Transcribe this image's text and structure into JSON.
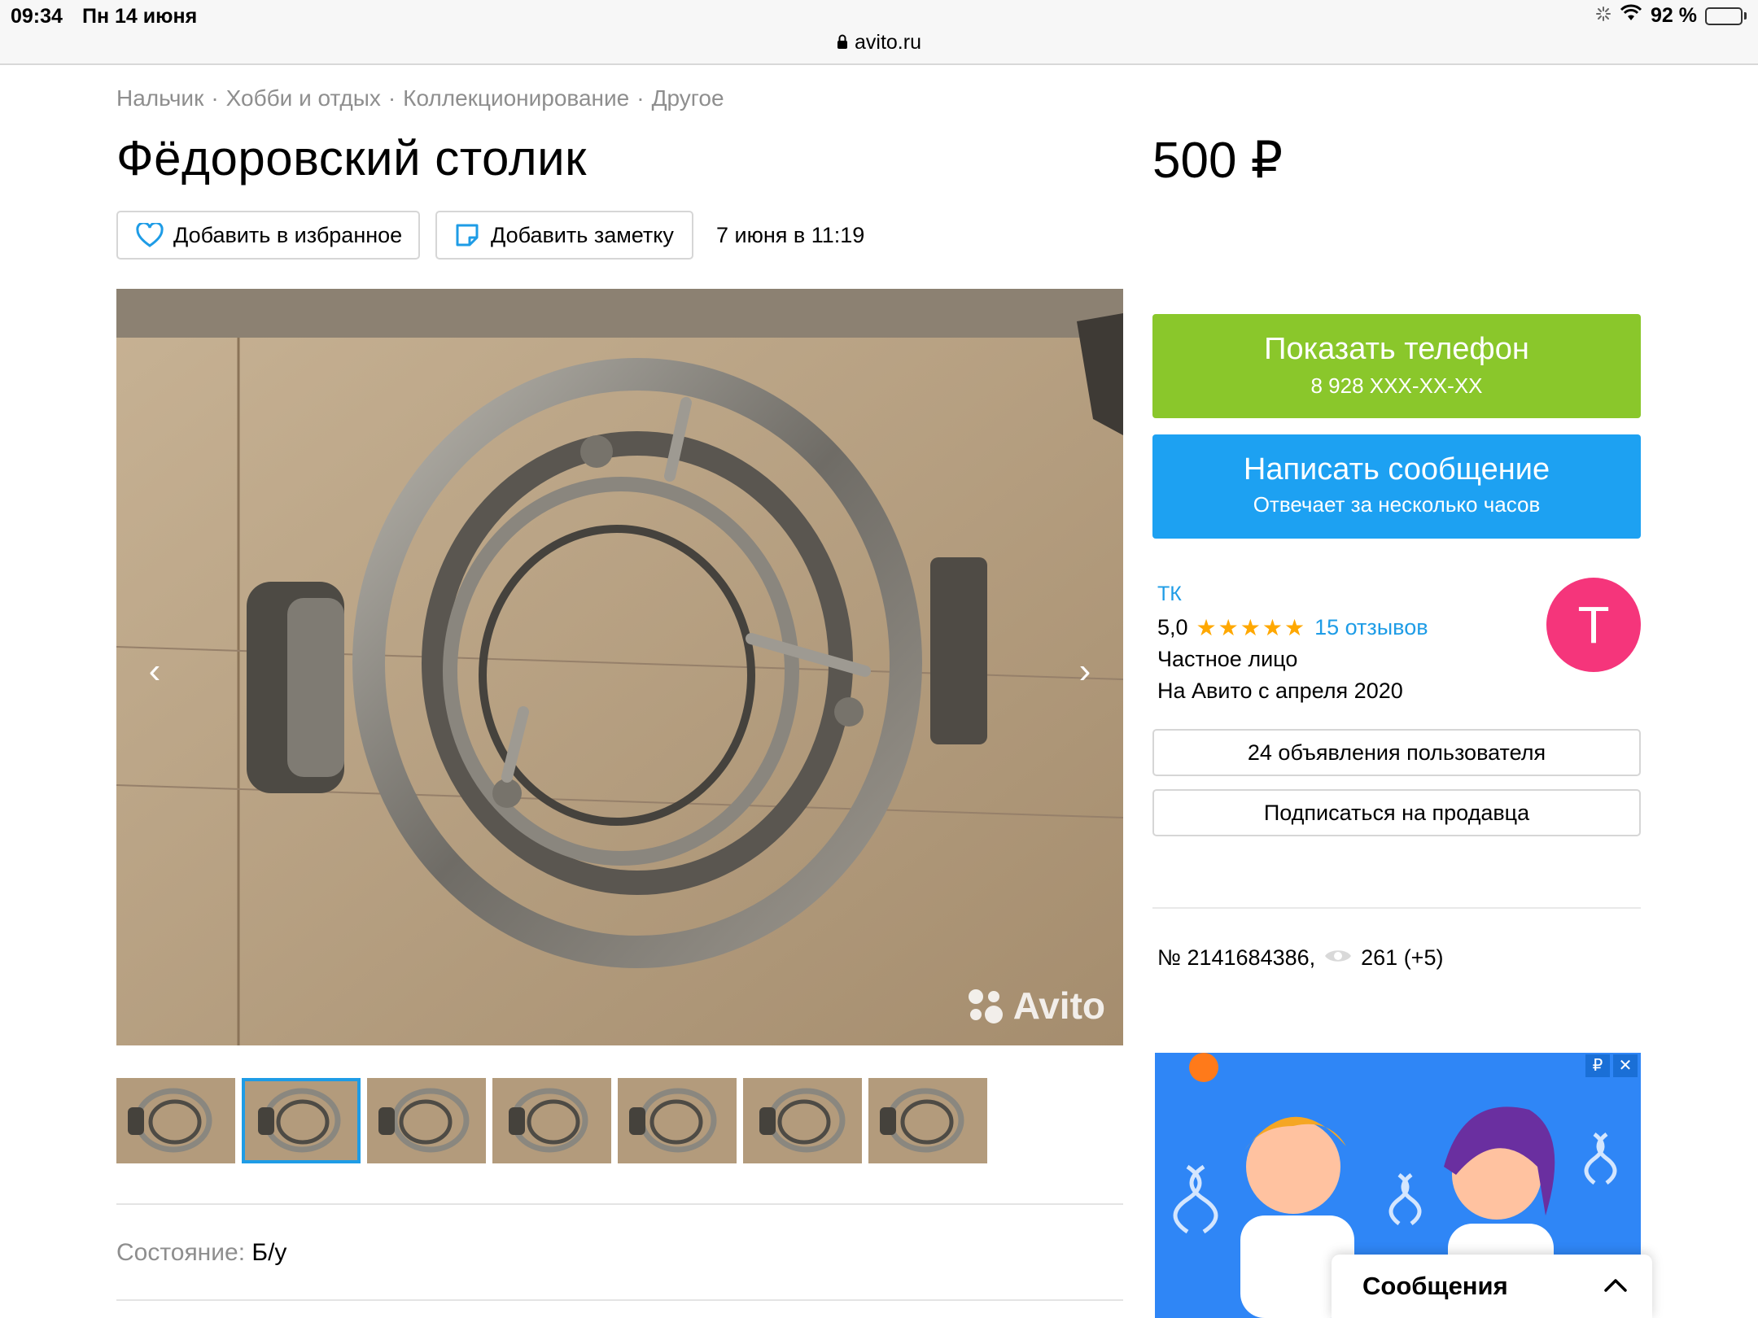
{
  "status_bar": {
    "time": "09:34",
    "date": "Пн 14 июня",
    "battery": "92 %",
    "battery_level": 0.92,
    "url": "avito.ru"
  },
  "breadcrumb": [
    "Нальчик",
    "Хобби и отдых",
    "Коллекционирование",
    "Другое"
  ],
  "breadcrumb_separator": "·",
  "listing": {
    "title": "Фёдоровский столик",
    "price": "500 ₽",
    "add_favorite_label": "Добавить в избранное",
    "add_note_label": "Добавить заметку",
    "published": "7 июня в 11:19",
    "photo_count": 7,
    "active_thumb": 1,
    "condition_label": "Состояние:",
    "condition_value": "Б/у",
    "watermark": "Avito"
  },
  "contact": {
    "show_phone_label": "Показать телефон",
    "phone_masked": "8 928 XXX-XX-XX",
    "write_message_label": "Написать сообщение",
    "reply_time": "Отвечает за несколько часов"
  },
  "seller": {
    "name": "ТК",
    "rating": "5,0",
    "stars": "★★★★★",
    "reviews": "15 отзывов",
    "type": "Частное лицо",
    "since": "На Авито с апреля 2020",
    "avatar_letter": "T",
    "ads_button": "24 объявления пользователя",
    "subscribe_button": "Подписаться на продавца"
  },
  "item_meta": {
    "number": "№ 2141684386,",
    "views": "261 (+5)"
  },
  "ad": {
    "ruble_badge": "₽",
    "close": "✕"
  },
  "messages_panel": {
    "title": "Сообщения"
  },
  "colors": {
    "green": "#8ac72b",
    "blue": "#1da1f2",
    "link": "#1e9ce6",
    "avatar": "#f5357b",
    "star": "#ffa800"
  }
}
